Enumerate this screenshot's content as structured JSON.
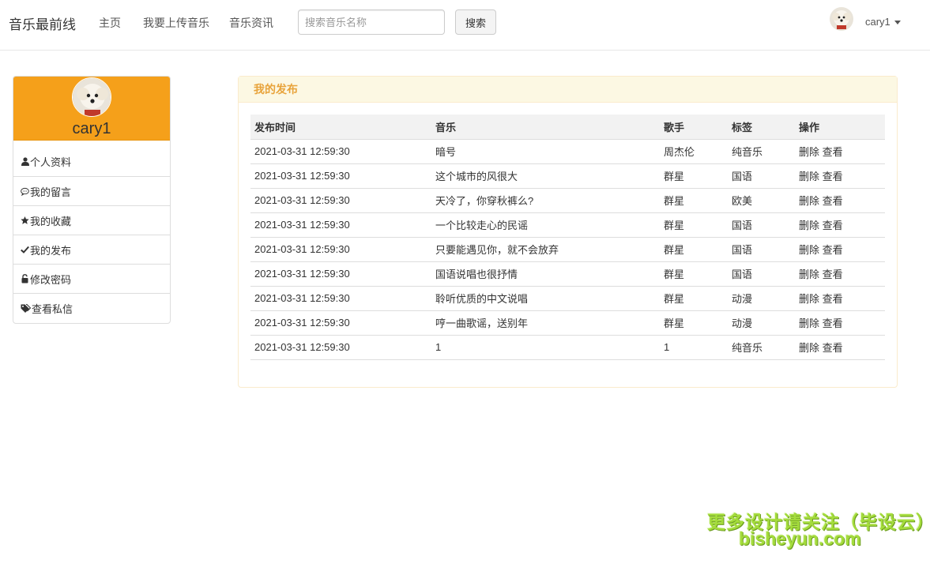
{
  "navbar": {
    "brand": "音乐最前线",
    "links": [
      "主页",
      "我要上传音乐",
      "音乐资讯"
    ],
    "search_placeholder": "搜索音乐名称",
    "search_button": "搜索",
    "username": "cary1"
  },
  "sidebar": {
    "username": "cary1",
    "header_color": "#f5a01a",
    "items": [
      {
        "label": "个人资料",
        "icon": "user-icon"
      },
      {
        "label": "我的留言",
        "icon": "comment-icon"
      },
      {
        "label": "我的收藏",
        "icon": "star-icon"
      },
      {
        "label": "我的发布",
        "icon": "check-icon"
      },
      {
        "label": "修改密码",
        "icon": "lock-icon"
      },
      {
        "label": "查看私信",
        "icon": "tags-icon"
      }
    ]
  },
  "panel": {
    "title": "我的发布",
    "columns": [
      "发布时间",
      "音乐",
      "歌手",
      "标签",
      "操作"
    ],
    "delete_label": "删除",
    "view_label": "查看",
    "rows": [
      {
        "time": "2021-03-31 12:59:30",
        "music": "暗号",
        "singer": "周杰伦",
        "tag": "纯音乐"
      },
      {
        "time": "2021-03-31 12:59:30",
        "music": "这个城市的风很大",
        "singer": "群星",
        "tag": "国语"
      },
      {
        "time": "2021-03-31 12:59:30",
        "music": "天冷了，你穿秋裤么?",
        "singer": "群星",
        "tag": "欧美"
      },
      {
        "time": "2021-03-31 12:59:30",
        "music": "一个比较走心的民谣",
        "singer": "群星",
        "tag": "国语"
      },
      {
        "time": "2021-03-31 12:59:30",
        "music": "只要能遇见你，就不会放弃",
        "singer": "群星",
        "tag": "国语"
      },
      {
        "time": "2021-03-31 12:59:30",
        "music": "国语说唱也很抒情",
        "singer": "群星",
        "tag": "国语"
      },
      {
        "time": "2021-03-31 12:59:30",
        "music": "聆听优质的中文说唱",
        "singer": "群星",
        "tag": "动漫"
      },
      {
        "time": "2021-03-31 12:59:30",
        "music": "哼一曲歌谣，送别年",
        "singer": "群星",
        "tag": "动漫"
      },
      {
        "time": "2021-03-31 12:59:30",
        "music": "1",
        "singer": "1",
        "tag": "纯音乐"
      }
    ]
  },
  "watermark": {
    "line1": "更多设计请关注（毕设云）",
    "line2": "bisheyun.com"
  }
}
